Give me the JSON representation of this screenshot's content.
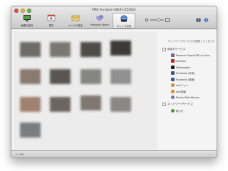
{
  "window": {
    "title": "PMB Portable (HDR-CX560V)"
  },
  "toolbar": {
    "items": [
      {
        "label": "画像を保存",
        "icon": "save-to-pc-icon"
      },
      {
        "label": "再生",
        "icon": "play-icon"
      },
      {
        "label": "メールで送る",
        "icon": "mail-icon"
      },
      {
        "label": "Personal Space",
        "icon": "personal-space-icon"
      },
      {
        "label": "ネットで共有",
        "icon": "share-online-icon"
      }
    ],
    "active_index": 4
  },
  "sidebar": {
    "prompt": "ネットワークサービスを選択してください",
    "groups": [
      {
        "label": "既定のサービス",
        "services": [
          {
            "label": "Personal Space(TM) by Sony",
            "color": "#6a6a9a"
          },
          {
            "label": "YouTube",
            "color": "#cc2222"
          },
          {
            "label": "Dailymotion",
            "color": "#1f1f1f"
          },
          {
            "label": "Facebook (写真)",
            "color": "#3b5998"
          },
          {
            "label": "Facebook (動画)",
            "color": "#3b5998"
          },
          {
            "label": "mixiフォト",
            "color": "#d98c1f"
          },
          {
            "label": "mixi動画",
            "color": "#d98c1f"
          },
          {
            "label": "Picasa Web Albums",
            "color": "#7e6fb5"
          }
        ]
      },
      {
        "label": "ネットワークサービス",
        "services": [
          {
            "label": "使い方",
            "color": "#4a9a3a"
          }
        ]
      }
    ]
  },
  "status": {
    "text": "1 / 101"
  }
}
